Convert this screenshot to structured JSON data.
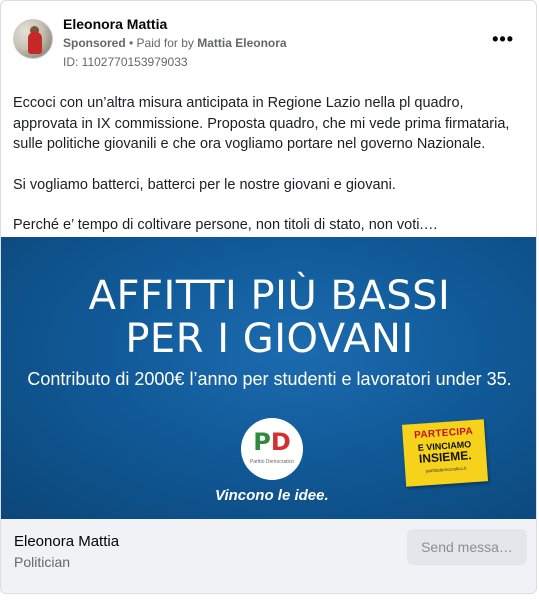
{
  "post": {
    "author": "Eleonora Mattia",
    "sponsored_label": "Sponsored",
    "paid_prefix": " • Paid for by ",
    "paid_by": "Mattia Eleonora",
    "ad_id": "ID: 1102770153979033",
    "more_icon": "more-dots-icon",
    "more_label": "•••",
    "text_paragraphs": [
      "Eccoci con un’altra misura anticipata in Regione Lazio nella pl quadro, approvata in IX commissione. Proposta quadro, che mi vede prima firmataria, sulle politiche giovanili e che ora vogliamo portare nel governo Nazionale.",
      "Si vogliamo batterci, batterci per le nostre giovani e giovani.",
      "Perché e’ tempo di coltivare persone, non titoli di stato, non voti.…"
    ]
  },
  "banner": {
    "headline_line1": "AFFITTI PIÙ BASSI",
    "headline_line2": "PER I GIOVANI",
    "subline": "Contributo di 2000€ l’anno per studenti e lavoratori under 35.",
    "logo_p": "P",
    "logo_d": "D",
    "logo_small": "Partito Democratico",
    "slogan": "Vincono le idee.",
    "sticker_line1": "PARTECIPA",
    "sticker_line2": "E VINCIAMO",
    "sticker_line3": "INSIEME.",
    "sticker_line4": "partitodemocratico.it",
    "background_color": "#115a98",
    "sticker_color": "#f6d21b"
  },
  "footer": {
    "name": "Eleonora Mattia",
    "role": "Politician",
    "send_label": "Send messa…"
  }
}
